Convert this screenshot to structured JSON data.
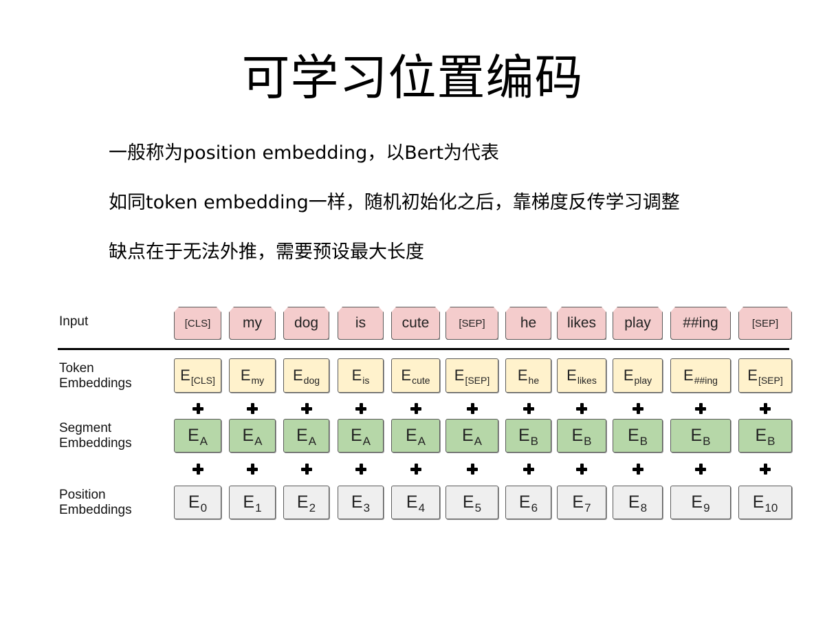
{
  "slide": {
    "title": "可学习位置编码",
    "bullets": [
      "一般称为position embedding，以Bert为代表",
      "如同token embedding一样，随机初始化之后，靠梯度反传学习调整",
      "缺点在于无法外推，需要预设最大长度"
    ]
  },
  "diagram": {
    "row_labels": {
      "input": "Input",
      "token": [
        "Token",
        "Embeddings"
      ],
      "segment": [
        "Segment",
        "Embeddings"
      ],
      "position": [
        "Position",
        "Embeddings"
      ]
    },
    "tokens": [
      "[CLS]",
      "my",
      "dog",
      "is",
      "cute",
      "[SEP]",
      "he",
      "likes",
      "play",
      "##ing",
      "[SEP]"
    ],
    "token_embeddings": [
      {
        "base": "E",
        "sub": "[CLS]"
      },
      {
        "base": "E",
        "sub": "my"
      },
      {
        "base": "E",
        "sub": "dog"
      },
      {
        "base": "E",
        "sub": "is"
      },
      {
        "base": "E",
        "sub": "cute"
      },
      {
        "base": "E",
        "sub": "[SEP]"
      },
      {
        "base": "E",
        "sub": "he"
      },
      {
        "base": "E",
        "sub": "likes"
      },
      {
        "base": "E",
        "sub": "play"
      },
      {
        "base": "E",
        "sub": "##ing"
      },
      {
        "base": "E",
        "sub": "[SEP]"
      }
    ],
    "segment_embeddings": [
      {
        "base": "E",
        "sub": "A"
      },
      {
        "base": "E",
        "sub": "A"
      },
      {
        "base": "E",
        "sub": "A"
      },
      {
        "base": "E",
        "sub": "A"
      },
      {
        "base": "E",
        "sub": "A"
      },
      {
        "base": "E",
        "sub": "A"
      },
      {
        "base": "E",
        "sub": "B"
      },
      {
        "base": "E",
        "sub": "B"
      },
      {
        "base": "E",
        "sub": "B"
      },
      {
        "base": "E",
        "sub": "B"
      },
      {
        "base": "E",
        "sub": "B"
      }
    ],
    "position_embeddings": [
      {
        "base": "E",
        "sub": "0"
      },
      {
        "base": "E",
        "sub": "1"
      },
      {
        "base": "E",
        "sub": "2"
      },
      {
        "base": "E",
        "sub": "3"
      },
      {
        "base": "E",
        "sub": "4"
      },
      {
        "base": "E",
        "sub": "5"
      },
      {
        "base": "E",
        "sub": "6"
      },
      {
        "base": "E",
        "sub": "7"
      },
      {
        "base": "E",
        "sub": "8"
      },
      {
        "base": "E",
        "sub": "9"
      },
      {
        "base": "E",
        "sub": "10"
      }
    ],
    "colors": {
      "input": "#f4cccc",
      "token": "#fff2cc",
      "segment": "#b6d7a8",
      "position": "#efefef",
      "border": "#5a5a5a"
    }
  }
}
